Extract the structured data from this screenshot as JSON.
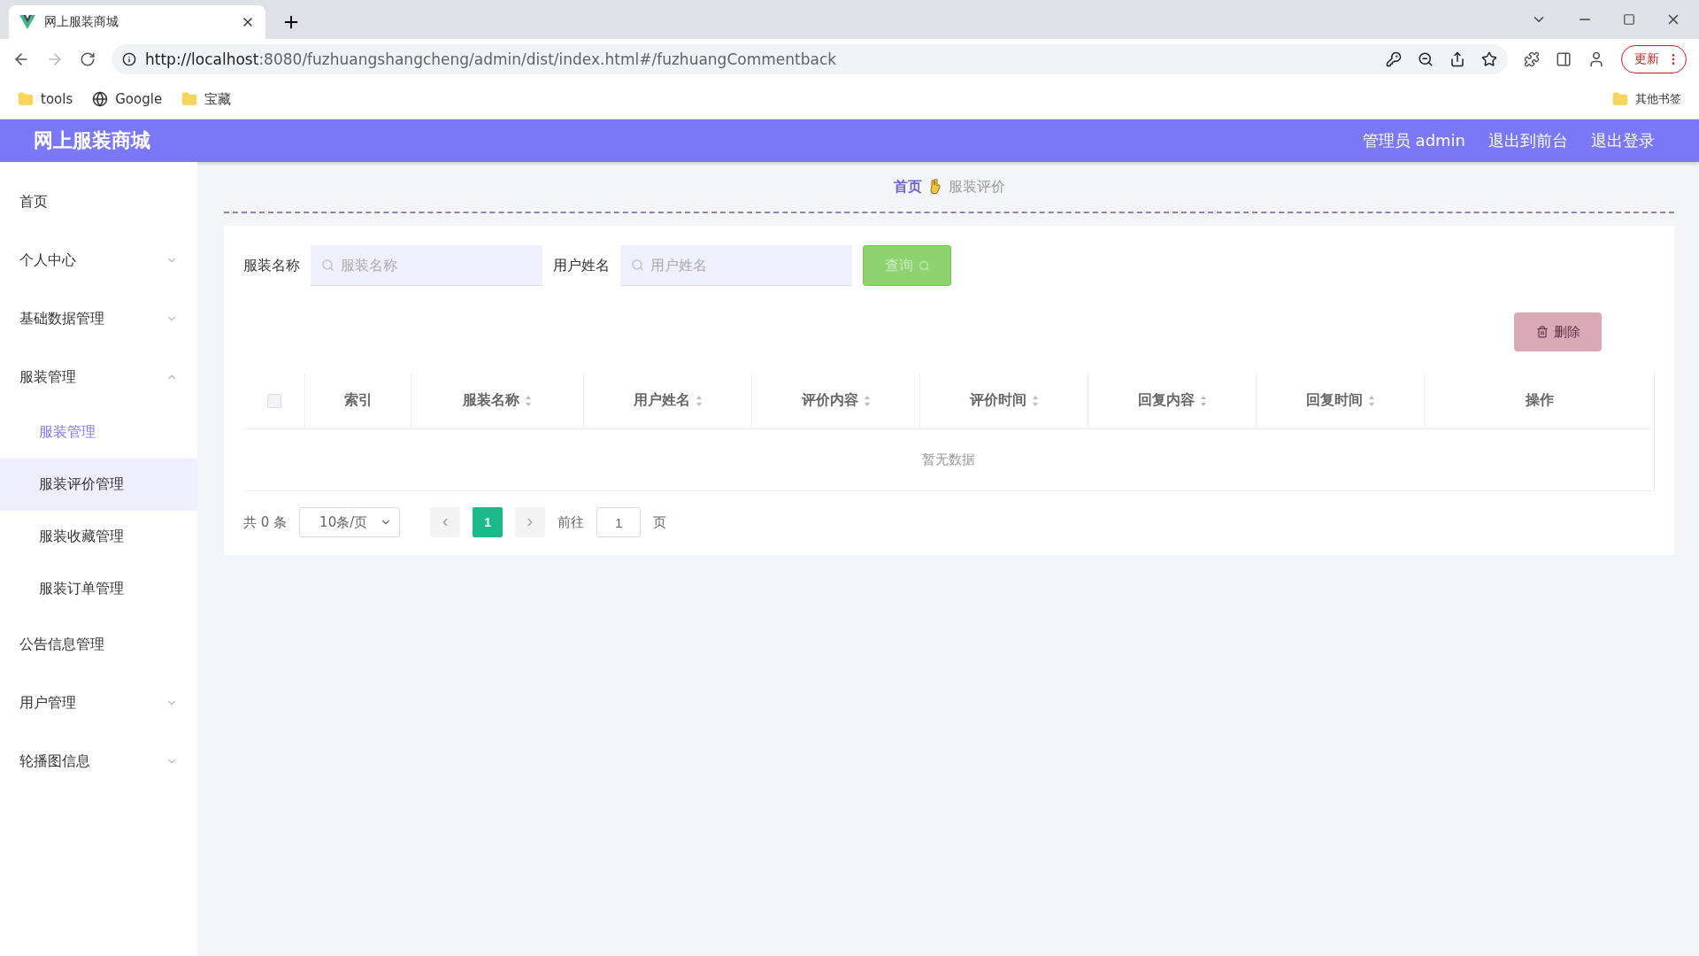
{
  "browser": {
    "tab_title": "网上服装商城",
    "url_host": "http://localhost",
    "url_rest": ":8080/fuzhuangshangcheng/admin/dist/index.html#/fuzhuangCommentback",
    "update_button": "更新",
    "bookmarks": [
      "tools",
      "Google",
      "宝藏"
    ],
    "other_bookmarks": "其他书签"
  },
  "header": {
    "title": "网上服装商城",
    "user": "管理员 admin",
    "links": [
      "退出到前台",
      "退出登录"
    ]
  },
  "sidebar": {
    "items": [
      {
        "label": "首页",
        "expandable": false
      },
      {
        "label": "个人中心",
        "expandable": true,
        "expanded": false
      },
      {
        "label": "基础数据管理",
        "expandable": true,
        "expanded": false
      },
      {
        "label": "服装管理",
        "expandable": true,
        "expanded": true,
        "children": [
          {
            "label": "服装管理",
            "active": true,
            "hovered": false
          },
          {
            "label": "服装评价管理",
            "active": false,
            "hovered": true
          },
          {
            "label": "服装收藏管理",
            "active": false,
            "hovered": false
          },
          {
            "label": "服装订单管理",
            "active": false,
            "hovered": false
          }
        ]
      },
      {
        "label": "公告信息管理",
        "expandable": false
      },
      {
        "label": "用户管理",
        "expandable": true,
        "expanded": false
      },
      {
        "label": "轮播图信息",
        "expandable": true,
        "expanded": false
      }
    ]
  },
  "breadcrumb": [
    "首页",
    "服装评价"
  ],
  "search": {
    "fields": [
      {
        "label": "服装名称",
        "placeholder": "服装名称"
      },
      {
        "label": "用户姓名",
        "placeholder": "用户姓名"
      }
    ],
    "button": "查询"
  },
  "delete_button": {
    "label": "删除",
    "disabled": true
  },
  "table": {
    "columns": [
      {
        "label": "索引",
        "sortable": false
      },
      {
        "label": "服装名称",
        "sortable": true
      },
      {
        "label": "用户姓名",
        "sortable": true
      },
      {
        "label": "评价内容",
        "sortable": true
      },
      {
        "label": "评价时间",
        "sortable": true
      },
      {
        "label": "回复内容",
        "sortable": true
      },
      {
        "label": "回复时间",
        "sortable": true
      },
      {
        "label": "操作",
        "sortable": false
      }
    ],
    "select_all_checked": false,
    "empty_text": "暂无数据"
  },
  "pagination": {
    "total": "共 0 条",
    "page_size": "10条/页",
    "pages": [
      {
        "label": "1",
        "selected": true
      }
    ],
    "goto_label": "前往",
    "goto_value": "1",
    "page_suffix": "页"
  }
}
